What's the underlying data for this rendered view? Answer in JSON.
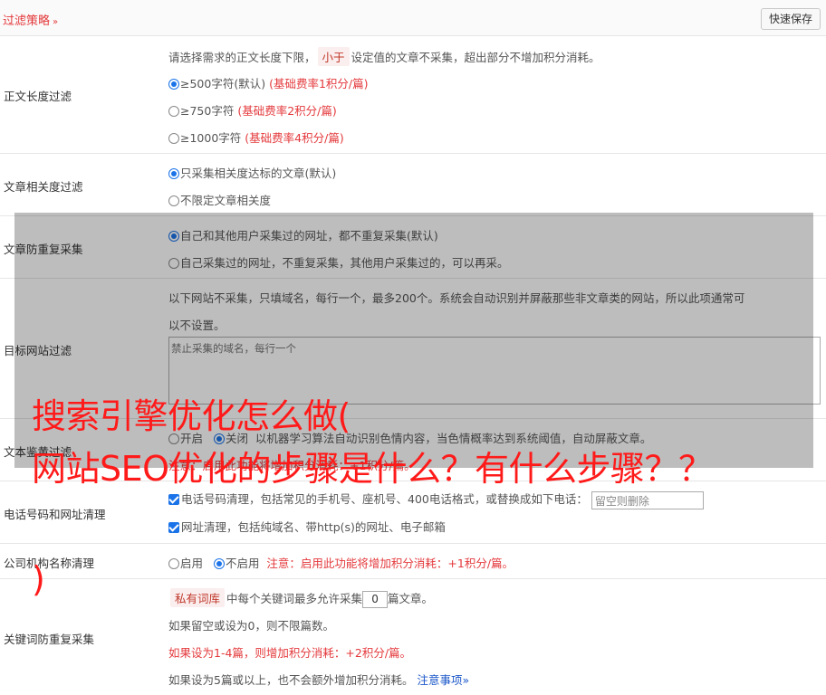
{
  "header": {
    "title": "过滤策略",
    "chevron": "»",
    "save_label": "快速保存"
  },
  "length": {
    "label": "正文长度过滤",
    "desc_pre": "请选择需求的正文长度下限，",
    "desc_tag": "小于",
    "desc_post": "设定值的文章不采集，超出部分不增加积分消耗。",
    "options": [
      {
        "text": "≥500字符(默认)",
        "rate": "(基础费率1积分/篇)"
      },
      {
        "text": "≥750字符",
        "rate": "(基础费率2积分/篇)"
      },
      {
        "text": "≥1000字符",
        "rate": "(基础费率4积分/篇)"
      }
    ]
  },
  "relevance": {
    "label": "文章相关度过滤",
    "options": [
      "只采集相关度达标的文章(默认)",
      "不限定文章相关度"
    ]
  },
  "dedupe": {
    "label": "文章防重复采集",
    "options": [
      "自己和其他用户采集过的网址，都不重复采集(默认)",
      "自己采集过的网址，不重复采集，其他用户采集过的，可以再采。"
    ]
  },
  "site": {
    "label": "目标网站过滤",
    "desc1": "以下网站不采集，只填域名，每行一个，最多200个。系统会自动识别并屏蔽那些非文章类的网站，所以此项通常可",
    "desc2": "以不设置。",
    "placeholder": "禁止采集的域名，每行一个"
  },
  "appraisal": {
    "label": "文本鉴黄过滤",
    "opt_on": "开启",
    "opt_off": "关闭",
    "desc": "以机器学习算法自动识别色情内容，当色情概率达到系统阈值，自动屏蔽文章。",
    "note_visible": "注意：启用此功能将增加积分消耗：+1积分/篇。"
  },
  "contact": {
    "label": "电话号码和网址清理",
    "phone_text": "电话号码清理，包括常见的手机号、座机号、400电话格式，或替换成如下电话：",
    "phone_placeholder": "留空则删除",
    "url_text": "网址清理，包括纯域名、带http(s)的网址、电子邮箱"
  },
  "company": {
    "label": "公司机构名称清理",
    "opt_on": "启用",
    "opt_off": "不启用",
    "note": "注意：启用此功能将增加积分消耗：+1积分/篇。"
  },
  "keyword": {
    "label": "关键词防重复采集",
    "tag": "私有词库",
    "line1_pre": "中每个关键词最多允许采集",
    "value": "0",
    "line1_post": "篇文章。",
    "line2": "如果留空或设为0，则不限篇数。",
    "line3": "如果设为1-4篇，则增加积分消耗：+2积分/篇。",
    "line4": "如果设为5篇或以上，也不会额外增加积分消耗。",
    "link": "注意事项",
    "link_chev": "»"
  },
  "watermark": {
    "line1": "搜索引擎优化怎么做(",
    "line2": "网站SEO优化的步骤是什么？有什么步骤？？",
    "line3": ")"
  },
  "colors": {
    "accent": "#e4393c",
    "link": "#1a56c8",
    "check": "#1a73e8"
  }
}
